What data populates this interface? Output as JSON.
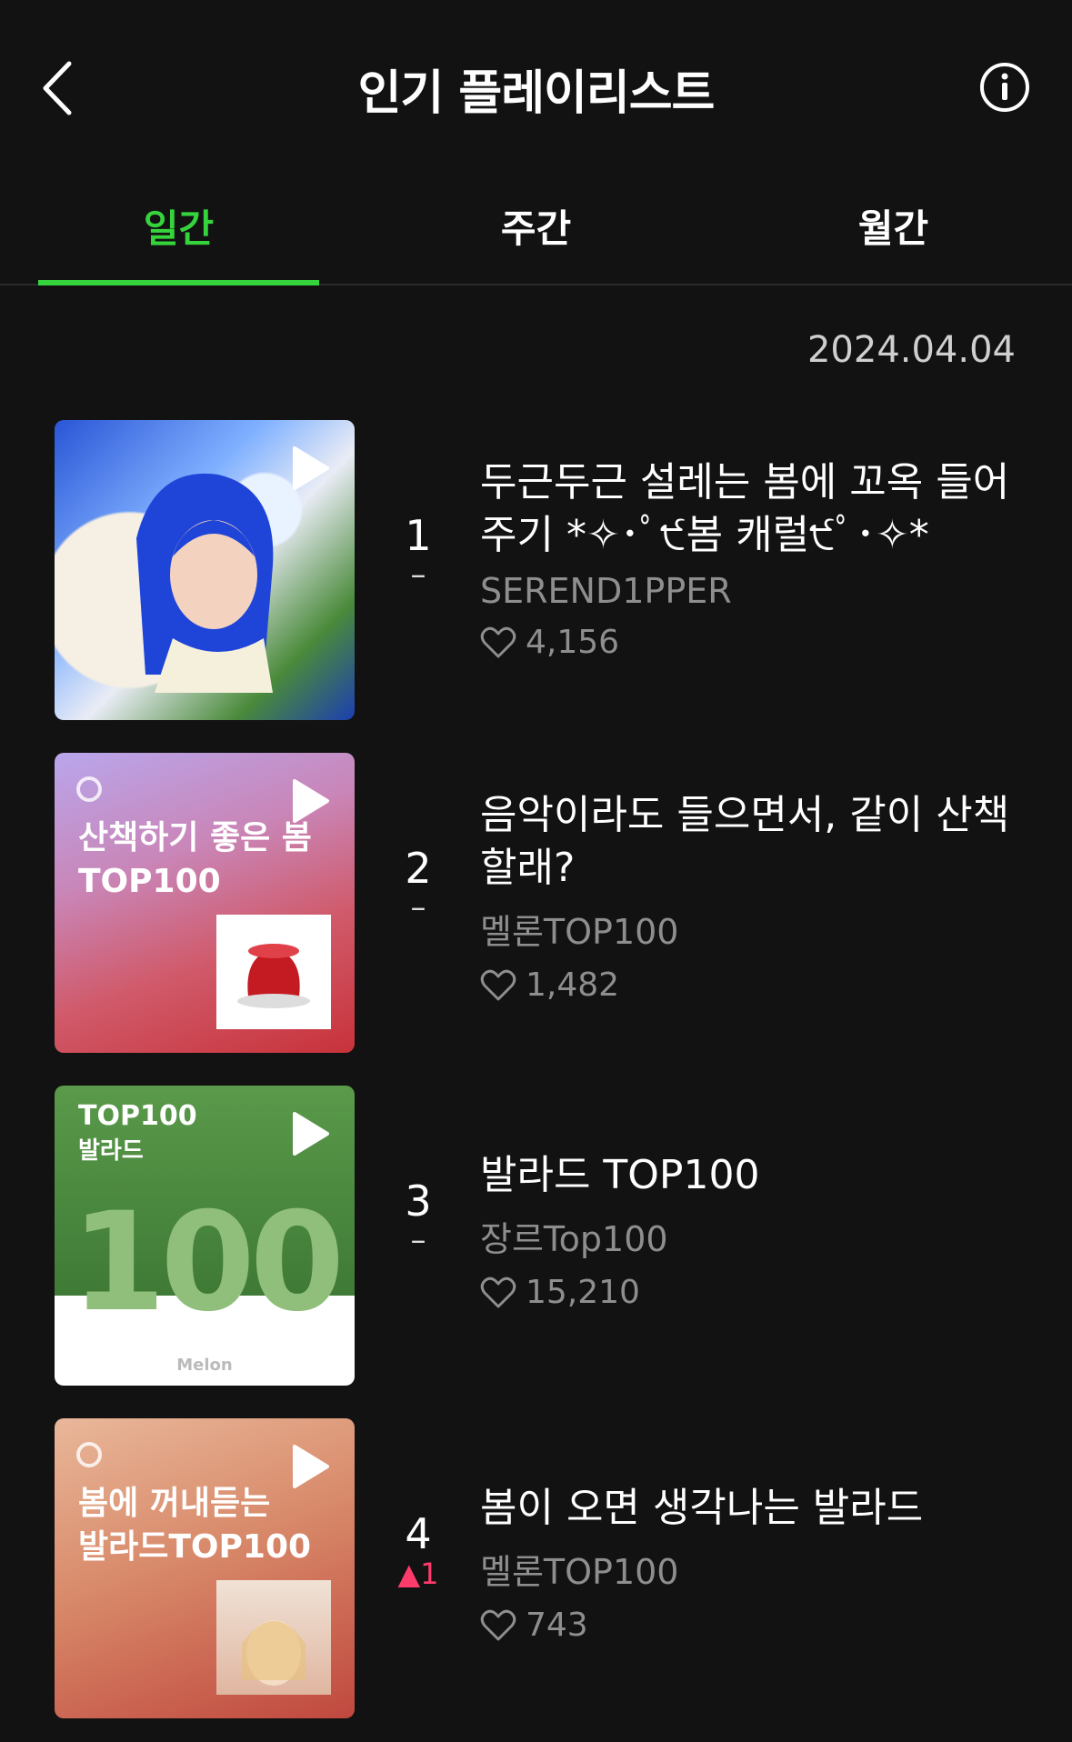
{
  "header": {
    "title": "인기 플레이리스트"
  },
  "tabs": [
    {
      "label": "일간",
      "active": true
    },
    {
      "label": "주간",
      "active": false
    },
    {
      "label": "월간",
      "active": false
    }
  ],
  "date": "2024.04.04",
  "colors": {
    "accent": "#35d33c",
    "rank_up": "#ff3b6b"
  },
  "playlists": [
    {
      "rank": "1",
      "change": "–",
      "title": "두근두근 설레는 봄에 꼬옥 들어 주기 *✧･ﾟ੯봄 캐럴੯ﾟ･✧*",
      "owner": "SEREND1PPER",
      "likes": "4,156"
    },
    {
      "rank": "2",
      "change": "–",
      "title": "음악이라도 들으면서, 같이 산책할래?",
      "owner": "멜론TOP100",
      "likes": "1,482",
      "cover_text": "산책하기 좋은 봄\nTOP100"
    },
    {
      "rank": "3",
      "change": "–",
      "title": "발라드 TOP100",
      "owner": "장르Top100",
      "likes": "15,210",
      "cover_text": "TOP100",
      "cover_sub": "발라드",
      "cover_big": "100",
      "cover_brand": "Melon"
    },
    {
      "rank": "4",
      "change": "1",
      "change_dir": "up",
      "title": "봄이 오면 생각나는 발라드",
      "owner": "멜론TOP100",
      "likes": "743",
      "cover_text": "봄에 꺼내듣는\n발라드TOP100"
    }
  ]
}
